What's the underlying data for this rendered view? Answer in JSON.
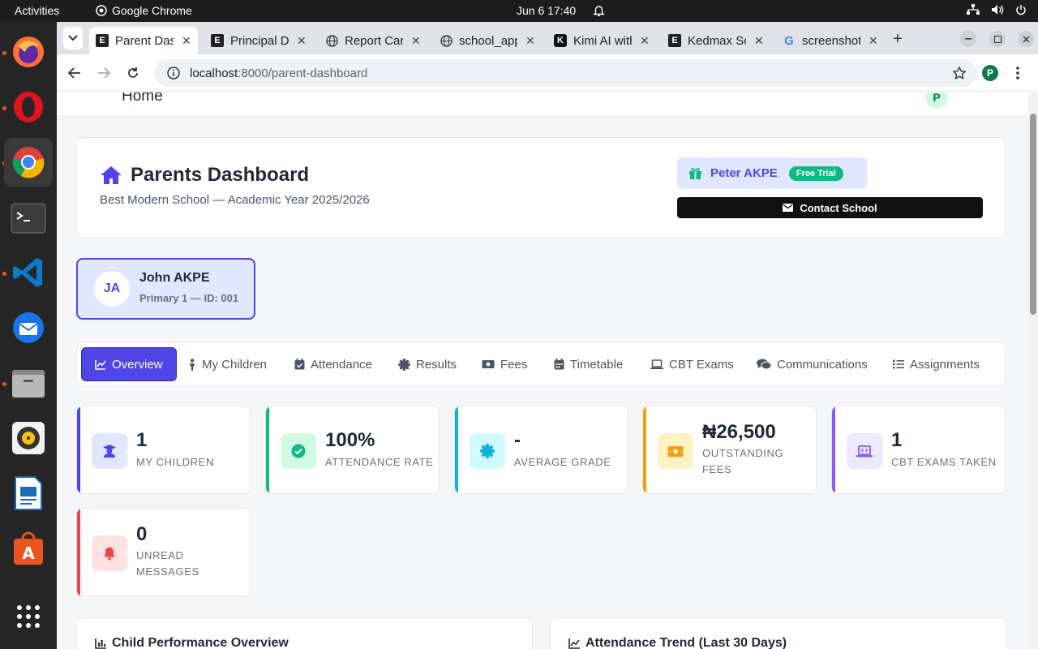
{
  "system_bar": {
    "activities": "Activities",
    "app_name": "Google Chrome",
    "clock": "Jun 6  17:40"
  },
  "browser": {
    "tabs": [
      {
        "title": "Parent Dashboard",
        "favicon": "E",
        "active": true
      },
      {
        "title": "Principal Dashboard",
        "favicon": "E",
        "active": false
      },
      {
        "title": "Report Card",
        "favicon": "globe",
        "active": false
      },
      {
        "title": "school_app",
        "favicon": "globe",
        "active": false
      },
      {
        "title": "Kimi AI with",
        "favicon": "K",
        "active": false
      },
      {
        "title": "Kedmax School",
        "favicon": "E",
        "active": false
      },
      {
        "title": "screenshot",
        "favicon": "G",
        "active": false
      }
    ],
    "url_host": "localhost",
    "url_path": ":8000/parent-dashboard",
    "profile_initial": "P"
  },
  "topnav": {
    "title": "Home",
    "avatar_initial": "P"
  },
  "header": {
    "title": "Parents Dashboard",
    "subtitle": "Best Modern School — Academic Year 2025/2026",
    "parent_name": "Peter AKPE",
    "plan_badge": "Free Trial",
    "contact_button": "Contact School"
  },
  "child": {
    "initials": "JA",
    "name": "John AKPE",
    "info": "Primary 1 — ID: 001"
  },
  "tabs": [
    {
      "label": "Overview",
      "icon": "chart-line-icon",
      "active": true
    },
    {
      "label": "My Children",
      "icon": "child-icon",
      "active": false
    },
    {
      "label": "Attendance",
      "icon": "calendar-check-icon",
      "active": false
    },
    {
      "label": "Results",
      "icon": "certificate-icon",
      "active": false
    },
    {
      "label": "Fees",
      "icon": "money-icon",
      "active": false
    },
    {
      "label": "Timetable",
      "icon": "calendar-icon",
      "active": false
    },
    {
      "label": "CBT Exams",
      "icon": "laptop-icon",
      "active": false
    },
    {
      "label": "Communications",
      "icon": "comments-icon",
      "active": false
    },
    {
      "label": "Assignments",
      "icon": "tasks-icon",
      "active": false
    }
  ],
  "stats": [
    {
      "value": "1",
      "label": "MY CHILDREN",
      "color": "#4f46e5",
      "icon": "graduate-icon"
    },
    {
      "value": "100%",
      "label": "ATTENDANCE RATE",
      "color": "#10b981",
      "icon": "check-circle-icon"
    },
    {
      "value": "-",
      "label": "AVERAGE GRADE",
      "color": "#06b6d4",
      "icon": "certificate-icon"
    },
    {
      "value": "₦26,500",
      "label": "OUTSTANDING FEES",
      "color": "#f59e0b",
      "icon": "money-bill-icon"
    },
    {
      "value": "1",
      "label": "CBT EXAMS TAKEN",
      "color": "#8b5cf6",
      "icon": "laptop-code-icon"
    },
    {
      "value": "0",
      "label": "UNREAD MESSAGES",
      "color": "#ef4444",
      "icon": "bell-icon"
    }
  ],
  "sections": {
    "performance_title": "Child Performance Overview",
    "attendance_title": "Attendance Trend (Last 30 Days)"
  }
}
